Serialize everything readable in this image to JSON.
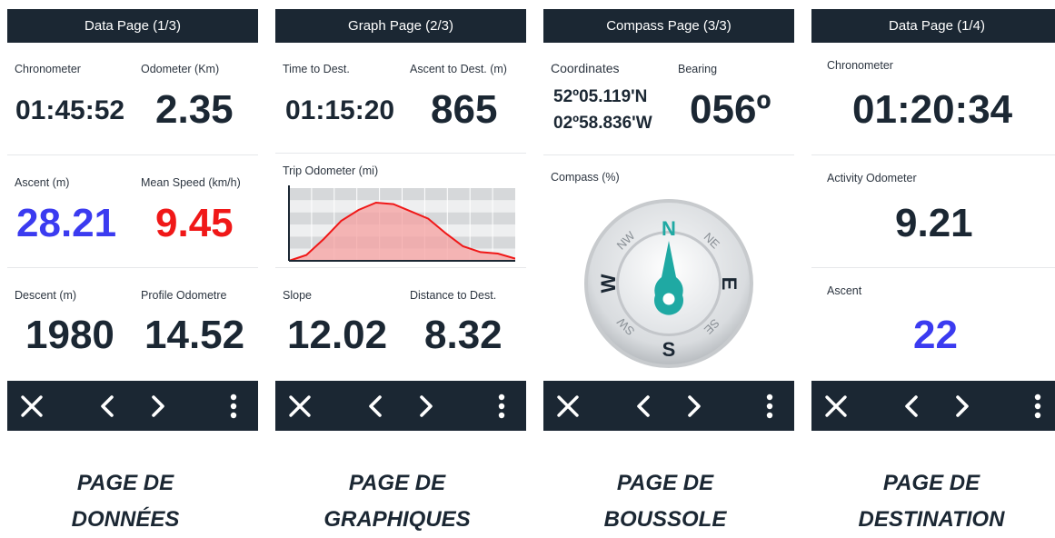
{
  "panels": [
    {
      "title": "Data Page (1/3)",
      "fields": [
        {
          "label": "Chronometer",
          "value": "01:45:52"
        },
        {
          "label": "Odometer (Km)",
          "value": "2.35"
        },
        {
          "label": "Ascent (m)",
          "value": "28.21"
        },
        {
          "label": "Mean Speed (km/h)",
          "value": "9.45"
        },
        {
          "label": "Descent (m)",
          "value": "1980"
        },
        {
          "label": "Profile Odometre",
          "value": "14.52"
        }
      ],
      "caption": [
        "PAGE DE",
        "DONNÉES"
      ]
    },
    {
      "title": "Graph Page (2/3)",
      "fields": [
        {
          "label": "Time to Dest.",
          "value": "01:15:20"
        },
        {
          "label": "Ascent to Dest. (m)",
          "value": "865"
        },
        {
          "label": "Trip Odometer (mi)",
          "value": ""
        },
        {
          "label": "Slope",
          "value": "12.02"
        },
        {
          "label": "Distance to Dest.",
          "value": "8.32"
        }
      ],
      "caption": [
        "PAGE DE",
        "GRAPHIQUES"
      ]
    },
    {
      "title": "Compass Page (3/3)",
      "fields": [
        {
          "label": "Coordinates",
          "value": "52º05.119'N",
          "value2": "02º58.836'W"
        },
        {
          "label": "Bearing",
          "value": "056º"
        },
        {
          "label": "Compass (%)",
          "value": ""
        }
      ],
      "compass": {
        "n": "N",
        "s": "S",
        "e": "E",
        "w": "W",
        "ne": "NE",
        "nw": "NW",
        "se": "SE",
        "sw": "SW"
      },
      "caption": [
        "PAGE DE",
        "BOUSSOLE"
      ]
    },
    {
      "title": "Data Page (1/4)",
      "fields": [
        {
          "label": "Chronometer",
          "value": "01:20:34"
        },
        {
          "label": "Activity Odometer",
          "value": "9.21"
        },
        {
          "label": "Ascent",
          "value": "22"
        }
      ],
      "caption": [
        "PAGE DE",
        "DESTINATION"
      ]
    }
  ],
  "colors": {
    "dark": "#1b2733",
    "blue": "#3b3bf0",
    "red": "#f01818",
    "teal": "#1fa9a3"
  },
  "icons": [
    "close-icon",
    "chevron-left-icon",
    "chevron-right-icon",
    "more-vertical-icon"
  ],
  "chart_data": {
    "type": "area",
    "series": [
      {
        "values": [
          0,
          8,
          30,
          55,
          70,
          80,
          78,
          68,
          58,
          38,
          20,
          12,
          10,
          3
        ]
      }
    ],
    "ylim": [
      0,
      100
    ]
  }
}
